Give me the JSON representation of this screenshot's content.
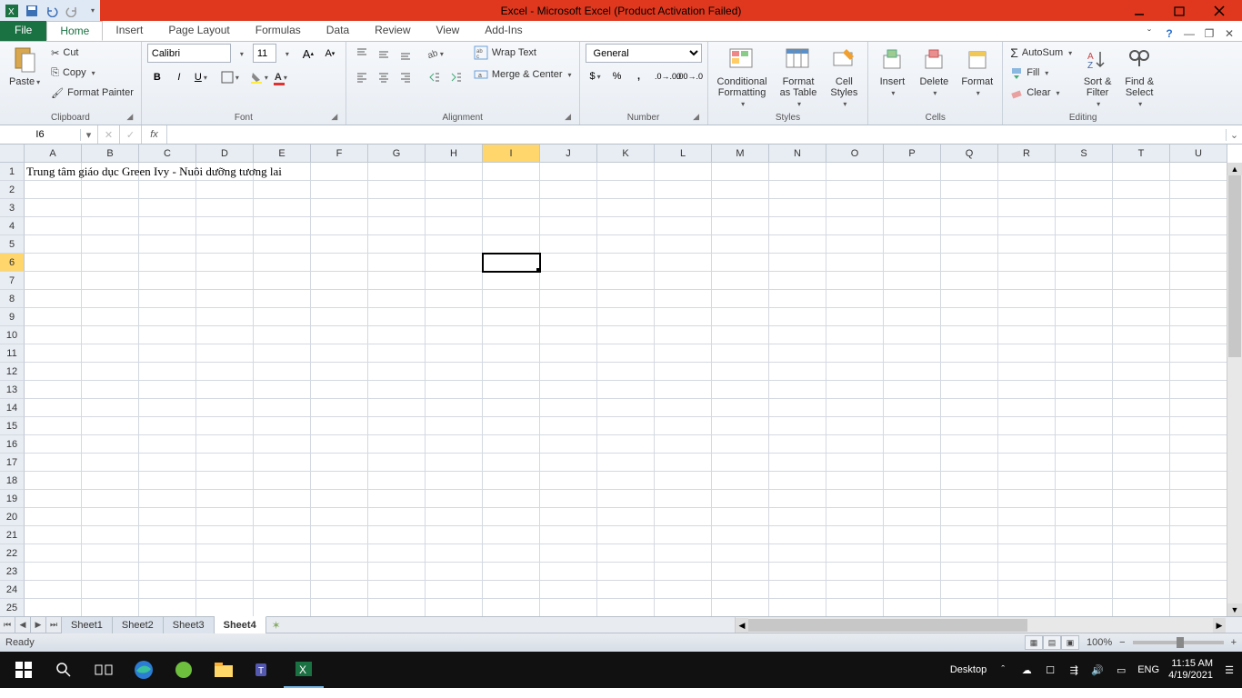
{
  "titlebar": {
    "title": "Excel  -  Microsoft Excel (Product Activation Failed)"
  },
  "tabs": {
    "file": "File",
    "list": [
      "Home",
      "Insert",
      "Page Layout",
      "Formulas",
      "Data",
      "Review",
      "View",
      "Add-Ins"
    ],
    "active": "Home"
  },
  "ribbon": {
    "clipboard": {
      "paste": "Paste",
      "cut": "Cut",
      "copy": "Copy",
      "format_painter": "Format Painter",
      "label": "Clipboard"
    },
    "font": {
      "name": "Calibri",
      "size": "11",
      "label": "Font"
    },
    "alignment": {
      "wrap": "Wrap Text",
      "merge": "Merge & Center",
      "label": "Alignment"
    },
    "number": {
      "format": "General",
      "label": "Number"
    },
    "styles": {
      "conditional": "Conditional\nFormatting",
      "table": "Format\nas Table",
      "cell": "Cell\nStyles",
      "label": "Styles"
    },
    "cells": {
      "insert": "Insert",
      "delete": "Delete",
      "format": "Format",
      "label": "Cells"
    },
    "editing": {
      "autosum": "AutoSum",
      "fill": "Fill",
      "clear": "Clear",
      "sort": "Sort &\nFilter",
      "find": "Find &\nSelect",
      "label": "Editing"
    }
  },
  "formula_bar": {
    "name_box": "I6",
    "formula": ""
  },
  "grid": {
    "columns": [
      "A",
      "B",
      "C",
      "D",
      "E",
      "F",
      "G",
      "H",
      "I",
      "J",
      "K",
      "L",
      "M",
      "N",
      "O",
      "P",
      "Q",
      "R",
      "S",
      "T",
      "U"
    ],
    "rows": 25,
    "selected_col": "I",
    "selected_row": 6,
    "cells": {
      "A1": "Trung tâm giáo dục Green Ivy - Nuôi dưỡng tương lai"
    }
  },
  "sheets": {
    "list": [
      "Sheet1",
      "Sheet2",
      "Sheet3",
      "Sheet4"
    ],
    "active": "Sheet4"
  },
  "status": {
    "ready": "Ready",
    "zoom": "100%"
  },
  "taskbar": {
    "desktop": "Desktop",
    "lang": "ENG",
    "time": "11:15 AM",
    "date": "4/19/2021"
  }
}
